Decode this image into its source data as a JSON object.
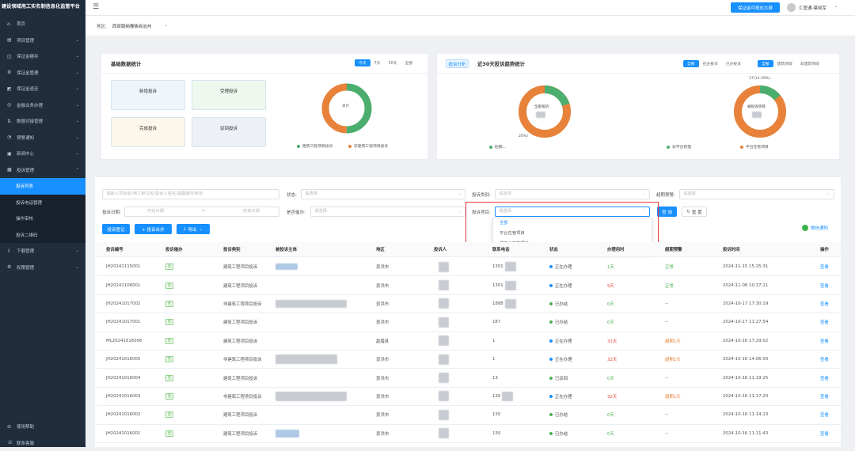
{
  "app": {
    "title": "建设领域用工实名制信息化监管平台"
  },
  "sidebar": {
    "items": [
      {
        "label": "首页",
        "icon": "home-icon",
        "glyph": "⌂",
        "arrow": false
      },
      {
        "label": "项目管理",
        "icon": "folder-icon",
        "glyph": "▤",
        "arrow": true
      },
      {
        "label": "保证金缴存",
        "icon": "deposit-icon",
        "glyph": "◫",
        "arrow": true
      },
      {
        "label": "保证金管理",
        "icon": "gear-icon",
        "glyph": "⚙",
        "arrow": true
      },
      {
        "label": "保证金退还",
        "icon": "refund-icon",
        "glyph": "◩",
        "arrow": true
      },
      {
        "label": "金融业务办理",
        "icon": "finance-icon",
        "glyph": "◎",
        "arrow": true
      },
      {
        "label": "数据对接管理",
        "icon": "data-link-icon",
        "glyph": "⇅",
        "arrow": true
      },
      {
        "label": "预警通知",
        "icon": "bell-icon",
        "glyph": "◔",
        "arrow": true
      },
      {
        "label": "新闻中心",
        "icon": "news-icon",
        "glyph": "▣",
        "arrow": true
      },
      {
        "label": "投诉管理",
        "icon": "complaint-icon",
        "glyph": "▦",
        "arrow": true,
        "open": true
      }
    ],
    "sub_items": [
      {
        "label": "投诉列表",
        "active": true
      },
      {
        "label": "投诉电话管理"
      },
      {
        "label": "操作审核"
      },
      {
        "label": "投诉二维码"
      }
    ],
    "items_after": [
      {
        "label": "下载管理",
        "icon": "download-icon",
        "glyph": "⇩",
        "arrow": true
      },
      {
        "label": "权限管理",
        "icon": "permission-icon",
        "glyph": "⚙",
        "arrow": true
      }
    ],
    "bottom": [
      {
        "label": "使用帮助",
        "icon": "help-icon",
        "glyph": "⊘"
      },
      {
        "label": "联系客服",
        "icon": "service-icon",
        "glyph": "☏"
      }
    ]
  },
  "topbar": {
    "visual_button": "保证金可视化大屏",
    "user_name": "汇管通-蔡晓军"
  },
  "filter": {
    "region_label": "地区:",
    "region_value": "西双版纳傣族自治州"
  },
  "stats_card": {
    "title": "基础数据统计",
    "ranges": [
      "今天",
      "7天",
      "30天",
      "全部"
    ],
    "tiles": [
      "新增投诉",
      "受理投诉",
      "完成投诉",
      "驳回投诉"
    ],
    "donut_center": "总计",
    "legend": [
      "建筑工程项目投诉",
      "非建筑工程项目投诉"
    ],
    "colors": {
      "green": "#4cae6e",
      "orange": "#e8823a"
    }
  },
  "trend_card": {
    "tab": "投诉分析",
    "title": "近30天投诉趋势统计",
    "group1": [
      "全部",
      "在办投诉",
      "已办投诉"
    ],
    "group2": [
      "全部",
      "建筑领域",
      "非建筑领域"
    ],
    "left_center": "全部投诉",
    "left_pct": "20%)",
    "left_legend": "赵楠...",
    "right_center": "被投诉项目",
    "right_annot": "17(14.29%)",
    "right_legend": [
      "非平台管理",
      "平台在管项目"
    ]
  },
  "search": {
    "keyword_placeholder": "请输入项目名/用工单位名/投诉人姓名/提醒服务电话",
    "status_label": "状态:",
    "status_placeholder": "请选择",
    "type_label": "投诉类别:",
    "type_placeholder": "请选择",
    "overdue_label": "超期预警:",
    "overdue_placeholder": "请选择",
    "date_label": "投诉日期:",
    "date_start": "开始日期",
    "date_sep": "~",
    "date_end": "结束日期",
    "urge_label": "是否催办:",
    "urge_placeholder": "请选择",
    "project_label": "投诉项目:",
    "project_placeholder": "请选择",
    "query_btn": "查 询",
    "reset_btn": "重 置",
    "dropdown_options": [
      "全部",
      "平台在管项目",
      "非平台在管项目"
    ]
  },
  "toolbar": {
    "register": "投诉登记",
    "merge": "+ 投诉合并",
    "export": "导出",
    "wechat": "微信通知"
  },
  "table": {
    "headers": [
      "投诉编号",
      "投诉催办",
      "投诉类别",
      "被投诉主体",
      "地区",
      "投诉人",
      "联系电话",
      "状态",
      "办理用时",
      "超期预警",
      "投诉时间",
      "操作"
    ],
    "rows": [
      {
        "id": "JH20241115001",
        "urge": "否",
        "type": "建筑工程项目投诉",
        "region": "景洪市",
        "phone": "1301",
        "status": "正在办理",
        "status_color": "#1890ff",
        "days": "1天",
        "days_color": "#4caf50",
        "warn": "正常",
        "warn_color": "#4caf50",
        "time": "2024-11-15 15:25:31",
        "op": "查看"
      },
      {
        "id": "JH20241108001",
        "urge": "否",
        "type": "建筑工程项目投诉",
        "region": "景洪市",
        "phone": "1301",
        "status": "正在办理",
        "status_color": "#1890ff",
        "days": "9天",
        "days_color": "#e8483a",
        "warn": "正常",
        "warn_color": "#4caf50",
        "time": "2024-11-08 10:37:11",
        "op": "查看"
      },
      {
        "id": "JH20241017002",
        "urge": "否",
        "type": "非建筑工程项目投诉",
        "region": "景洪市",
        "phone": "1888",
        "status": "已办结",
        "status_color": "#4caf50",
        "days": "0天",
        "days_color": "#4caf50",
        "warn": "--",
        "warn_color": "#555",
        "time": "2024-10-17 17:30:19",
        "op": "查看"
      },
      {
        "id": "JH20241017001",
        "urge": "否",
        "type": "建筑工程项目投诉",
        "region": "景洪市",
        "phone": "187",
        "status": "已办结",
        "status_color": "#4caf50",
        "days": "0天",
        "days_color": "#4caf50",
        "warn": "--",
        "warn_color": "#555",
        "time": "2024-10-17 11:27:54",
        "op": "查看"
      },
      {
        "id": "ML20241016006",
        "urge": "否",
        "type": "建筑工程项目投诉",
        "region": "勐腊县",
        "phone": "1",
        "status": "正在办理",
        "status_color": "#1890ff",
        "days": "31天",
        "days_color": "#e8483a",
        "warn": "超期1天",
        "warn_color": "#e8823a",
        "time": "2024-10-16 17:29:02",
        "op": "查看"
      },
      {
        "id": "JH20241016005",
        "urge": "否",
        "type": "非建筑工程项目投诉",
        "region": "景洪市",
        "phone": "1",
        "status": "正在办理",
        "status_color": "#1890ff",
        "days": "32天",
        "days_color": "#e8483a",
        "warn": "超期2天",
        "warn_color": "#e8823a",
        "time": "2024-10-16 14:06:00",
        "op": "查看"
      },
      {
        "id": "JH20241016004",
        "urge": "否",
        "type": "建筑工程项目投诉",
        "region": "景洪市",
        "phone": "13",
        "status": "已驳回",
        "status_color": "#4caf50",
        "days": "0天",
        "days_color": "#4caf50",
        "warn": "--",
        "warn_color": "#555",
        "time": "2024-10-16 11:19:25",
        "op": "查看"
      },
      {
        "id": "JH20241016003",
        "urge": "否",
        "type": "非建筑工程项目投诉",
        "region": "景洪市",
        "phone": "130",
        "status": "正在办理",
        "status_color": "#1890ff",
        "days": "32天",
        "days_color": "#e8483a",
        "warn": "超期2天",
        "warn_color": "#e8823a",
        "time": "2024-10-16 11:17:20",
        "op": "查看"
      },
      {
        "id": "JH20241016002",
        "urge": "否",
        "type": "建筑工程项目投诉",
        "region": "景洪市",
        "phone": "130",
        "status": "已办结",
        "status_color": "#4caf50",
        "days": "0天",
        "days_color": "#4caf50",
        "warn": "--",
        "warn_color": "#555",
        "time": "2024-10-16 11:14:13",
        "op": "查看"
      },
      {
        "id": "JH20241016001",
        "urge": "否",
        "type": "建筑工程项目投诉",
        "region": "景洪市",
        "phone": "130",
        "status": "已办结",
        "status_color": "#4caf50",
        "days": "0天",
        "days_color": "#4caf50",
        "warn": "--",
        "warn_color": "#555",
        "time": "2024-10-16 11:11:43",
        "op": "查看"
      }
    ]
  }
}
